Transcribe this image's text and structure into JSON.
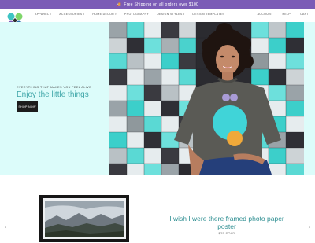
{
  "announcement": {
    "icon": "truck-icon",
    "text": "Free Shipping on all orders over $100"
  },
  "nav": {
    "items": [
      {
        "label": "APPAREL",
        "has_caret": true
      },
      {
        "label": "ACCESSORIES",
        "has_caret": true
      },
      {
        "label": "HOME DECOR",
        "has_caret": true
      },
      {
        "label": "PHOTOGRAPHY",
        "has_caret": false
      },
      {
        "label": "DESIGN STYLES",
        "has_caret": true
      },
      {
        "label": "DESIGN TEMPLATES",
        "has_caret": false
      }
    ],
    "right": {
      "account": "ACCOUNT",
      "help": "HELP",
      "cart": "CART"
    },
    "caret": "▾"
  },
  "hero": {
    "tagline": "EVERYTHING THAT MAKES YOU FEEL ALIVE",
    "title": "Enjoy the little things",
    "cta": "SHOP NOW"
  },
  "product": {
    "title": "I wish I were there framed photo paper poster",
    "price": "$25 SOLD"
  },
  "carousel": {
    "prev": "‹",
    "next": "›"
  },
  "colors": {
    "announce_bg": "#7b5bb6",
    "hero_bg": "#dcfcfa",
    "accent": "#3fa6a8"
  }
}
